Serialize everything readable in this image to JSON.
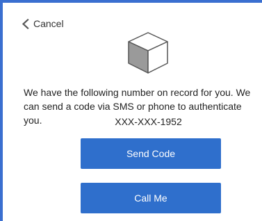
{
  "header": {
    "cancel_label": "Cancel",
    "back_icon": "chevron-left-icon"
  },
  "illustration": {
    "icon": "cube-icon"
  },
  "main": {
    "message": "We have the following number on record for you. We can send a code via SMS or phone to authenticate you.",
    "phone_number": "XXX-XXX-1952"
  },
  "actions": {
    "send_code_label": "Send Code",
    "call_me_label": "Call Me"
  },
  "colors": {
    "accent": "#2f6fcc",
    "border": "#3a6fd0"
  }
}
